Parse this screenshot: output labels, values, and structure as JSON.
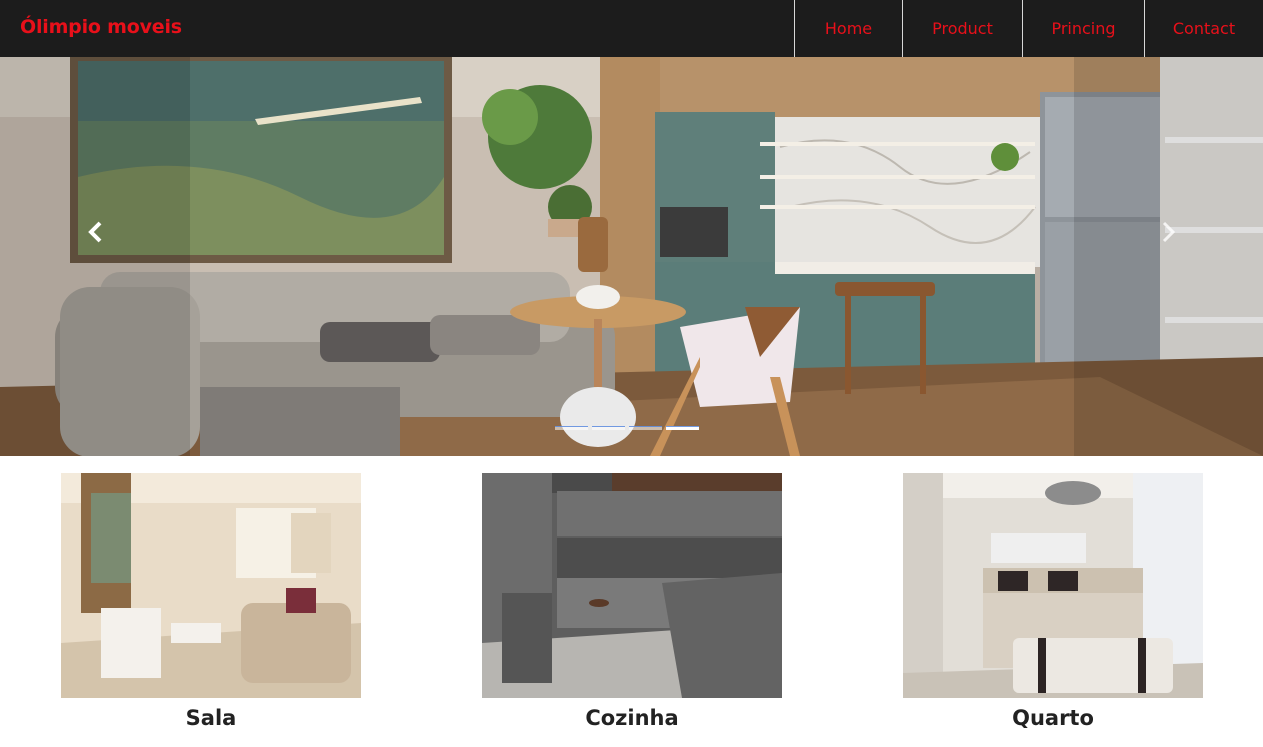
{
  "navbar": {
    "brand": "Ólimpio moveis",
    "items": [
      {
        "label": "Home"
      },
      {
        "label": "Product"
      },
      {
        "label": "Princing"
      },
      {
        "label": "Contact"
      }
    ]
  },
  "carousel": {
    "slide_count": 4,
    "active_index": 3,
    "prev_icon": "chevron-left-icon",
    "next_icon": "chevron-right-icon"
  },
  "cards": [
    {
      "title": "Sala"
    },
    {
      "title": "Cozinha"
    },
    {
      "title": "Quarto"
    }
  ],
  "colors": {
    "navbar_bg": "#1c1c1c",
    "brand_red": "#e8101a",
    "title_text": "#222222"
  }
}
